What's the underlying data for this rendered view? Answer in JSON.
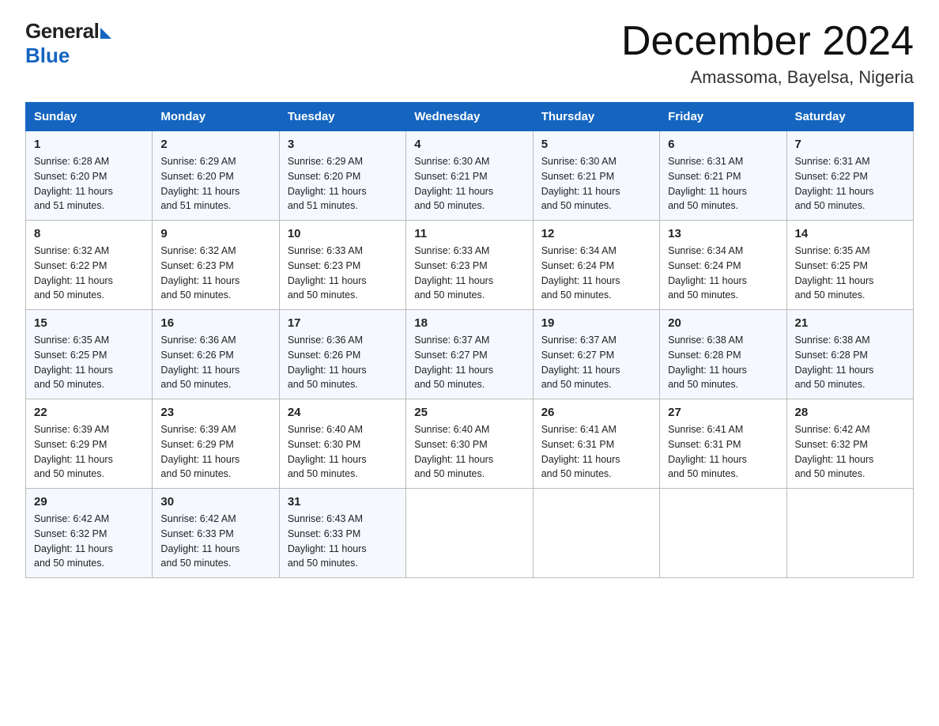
{
  "header": {
    "logo_general": "General",
    "logo_blue": "Blue",
    "month_title": "December 2024",
    "location": "Amassoma, Bayelsa, Nigeria"
  },
  "weekdays": [
    "Sunday",
    "Monday",
    "Tuesday",
    "Wednesday",
    "Thursday",
    "Friday",
    "Saturday"
  ],
  "weeks": [
    [
      {
        "day": 1,
        "sunrise": "6:28 AM",
        "sunset": "6:20 PM",
        "daylight": "11 hours and 51 minutes."
      },
      {
        "day": 2,
        "sunrise": "6:29 AM",
        "sunset": "6:20 PM",
        "daylight": "11 hours and 51 minutes."
      },
      {
        "day": 3,
        "sunrise": "6:29 AM",
        "sunset": "6:20 PM",
        "daylight": "11 hours and 51 minutes."
      },
      {
        "day": 4,
        "sunrise": "6:30 AM",
        "sunset": "6:21 PM",
        "daylight": "11 hours and 50 minutes."
      },
      {
        "day": 5,
        "sunrise": "6:30 AM",
        "sunset": "6:21 PM",
        "daylight": "11 hours and 50 minutes."
      },
      {
        "day": 6,
        "sunrise": "6:31 AM",
        "sunset": "6:21 PM",
        "daylight": "11 hours and 50 minutes."
      },
      {
        "day": 7,
        "sunrise": "6:31 AM",
        "sunset": "6:22 PM",
        "daylight": "11 hours and 50 minutes."
      }
    ],
    [
      {
        "day": 8,
        "sunrise": "6:32 AM",
        "sunset": "6:22 PM",
        "daylight": "11 hours and 50 minutes."
      },
      {
        "day": 9,
        "sunrise": "6:32 AM",
        "sunset": "6:23 PM",
        "daylight": "11 hours and 50 minutes."
      },
      {
        "day": 10,
        "sunrise": "6:33 AM",
        "sunset": "6:23 PM",
        "daylight": "11 hours and 50 minutes."
      },
      {
        "day": 11,
        "sunrise": "6:33 AM",
        "sunset": "6:23 PM",
        "daylight": "11 hours and 50 minutes."
      },
      {
        "day": 12,
        "sunrise": "6:34 AM",
        "sunset": "6:24 PM",
        "daylight": "11 hours and 50 minutes."
      },
      {
        "day": 13,
        "sunrise": "6:34 AM",
        "sunset": "6:24 PM",
        "daylight": "11 hours and 50 minutes."
      },
      {
        "day": 14,
        "sunrise": "6:35 AM",
        "sunset": "6:25 PM",
        "daylight": "11 hours and 50 minutes."
      }
    ],
    [
      {
        "day": 15,
        "sunrise": "6:35 AM",
        "sunset": "6:25 PM",
        "daylight": "11 hours and 50 minutes."
      },
      {
        "day": 16,
        "sunrise": "6:36 AM",
        "sunset": "6:26 PM",
        "daylight": "11 hours and 50 minutes."
      },
      {
        "day": 17,
        "sunrise": "6:36 AM",
        "sunset": "6:26 PM",
        "daylight": "11 hours and 50 minutes."
      },
      {
        "day": 18,
        "sunrise": "6:37 AM",
        "sunset": "6:27 PM",
        "daylight": "11 hours and 50 minutes."
      },
      {
        "day": 19,
        "sunrise": "6:37 AM",
        "sunset": "6:27 PM",
        "daylight": "11 hours and 50 minutes."
      },
      {
        "day": 20,
        "sunrise": "6:38 AM",
        "sunset": "6:28 PM",
        "daylight": "11 hours and 50 minutes."
      },
      {
        "day": 21,
        "sunrise": "6:38 AM",
        "sunset": "6:28 PM",
        "daylight": "11 hours and 50 minutes."
      }
    ],
    [
      {
        "day": 22,
        "sunrise": "6:39 AM",
        "sunset": "6:29 PM",
        "daylight": "11 hours and 50 minutes."
      },
      {
        "day": 23,
        "sunrise": "6:39 AM",
        "sunset": "6:29 PM",
        "daylight": "11 hours and 50 minutes."
      },
      {
        "day": 24,
        "sunrise": "6:40 AM",
        "sunset": "6:30 PM",
        "daylight": "11 hours and 50 minutes."
      },
      {
        "day": 25,
        "sunrise": "6:40 AM",
        "sunset": "6:30 PM",
        "daylight": "11 hours and 50 minutes."
      },
      {
        "day": 26,
        "sunrise": "6:41 AM",
        "sunset": "6:31 PM",
        "daylight": "11 hours and 50 minutes."
      },
      {
        "day": 27,
        "sunrise": "6:41 AM",
        "sunset": "6:31 PM",
        "daylight": "11 hours and 50 minutes."
      },
      {
        "day": 28,
        "sunrise": "6:42 AM",
        "sunset": "6:32 PM",
        "daylight": "11 hours and 50 minutes."
      }
    ],
    [
      {
        "day": 29,
        "sunrise": "6:42 AM",
        "sunset": "6:32 PM",
        "daylight": "11 hours and 50 minutes."
      },
      {
        "day": 30,
        "sunrise": "6:42 AM",
        "sunset": "6:33 PM",
        "daylight": "11 hours and 50 minutes."
      },
      {
        "day": 31,
        "sunrise": "6:43 AM",
        "sunset": "6:33 PM",
        "daylight": "11 hours and 50 minutes."
      },
      null,
      null,
      null,
      null
    ]
  ],
  "labels": {
    "sunrise": "Sunrise:",
    "sunset": "Sunset:",
    "daylight": "Daylight:"
  }
}
